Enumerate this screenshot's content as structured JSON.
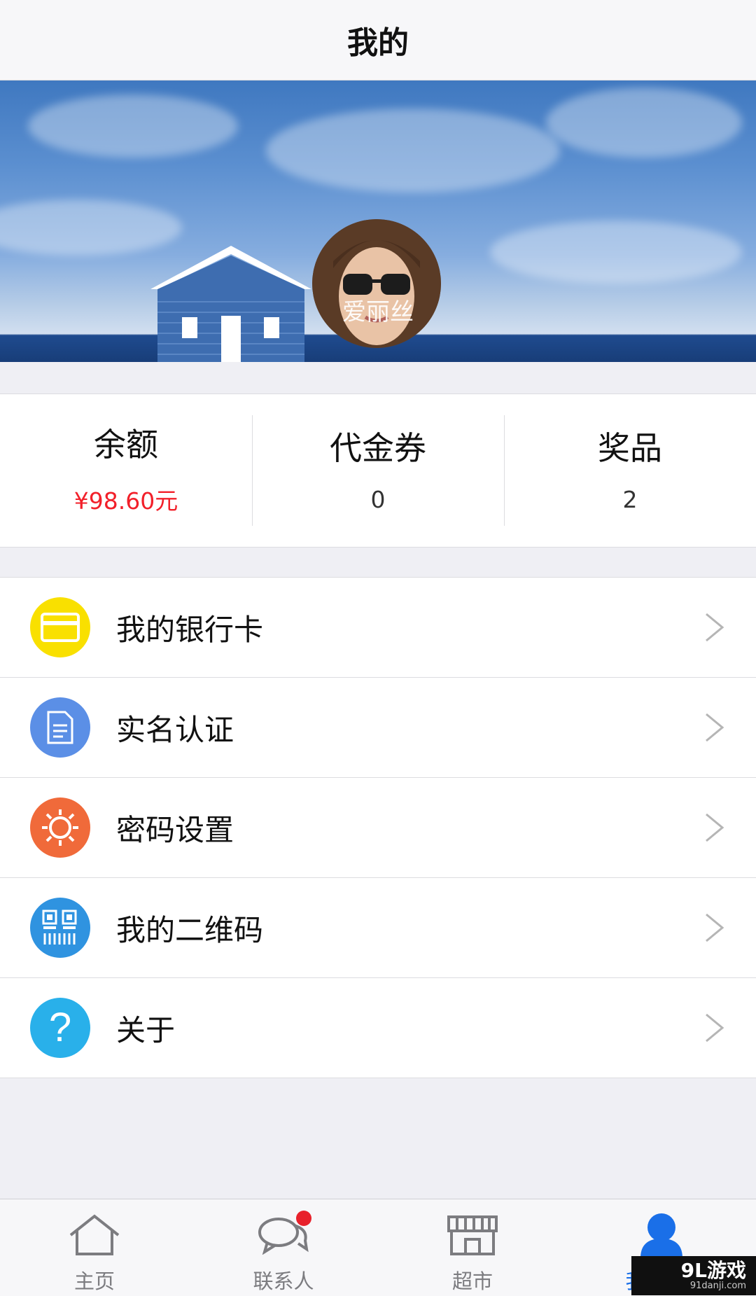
{
  "header": {
    "title": "我的"
  },
  "profile": {
    "name": "爱丽丝"
  },
  "stats": [
    {
      "label": "余额",
      "value": "¥98.60元",
      "color": "#f2202a"
    },
    {
      "label": "代金券",
      "value": "0"
    },
    {
      "label": "奖品",
      "value": "2"
    }
  ],
  "menu": [
    {
      "label": "我的银行卡",
      "icon": "bank-card-icon",
      "color": "#f9e000"
    },
    {
      "label": "实名认证",
      "icon": "document-icon",
      "color": "#5b8fe6"
    },
    {
      "label": "密码设置",
      "icon": "settings-gear-icon",
      "color": "#f06a3a"
    },
    {
      "label": "我的二维码",
      "icon": "qr-code-icon",
      "color": "#2f93e0"
    },
    {
      "label": "关于",
      "icon": "question-icon",
      "color": "#29b0ea"
    }
  ],
  "tabs": [
    {
      "label": "主页",
      "icon": "home-icon"
    },
    {
      "label": "联系人",
      "icon": "chat-icon",
      "badge": true
    },
    {
      "label": "超市",
      "icon": "store-icon"
    },
    {
      "label": "我",
      "icon": "user-icon",
      "active": true
    }
  ],
  "watermark": {
    "main": "9L游戏",
    "sub": "91danji.com"
  },
  "colors": {
    "accent": "#1a6fe8",
    "background": "#efeff4"
  }
}
